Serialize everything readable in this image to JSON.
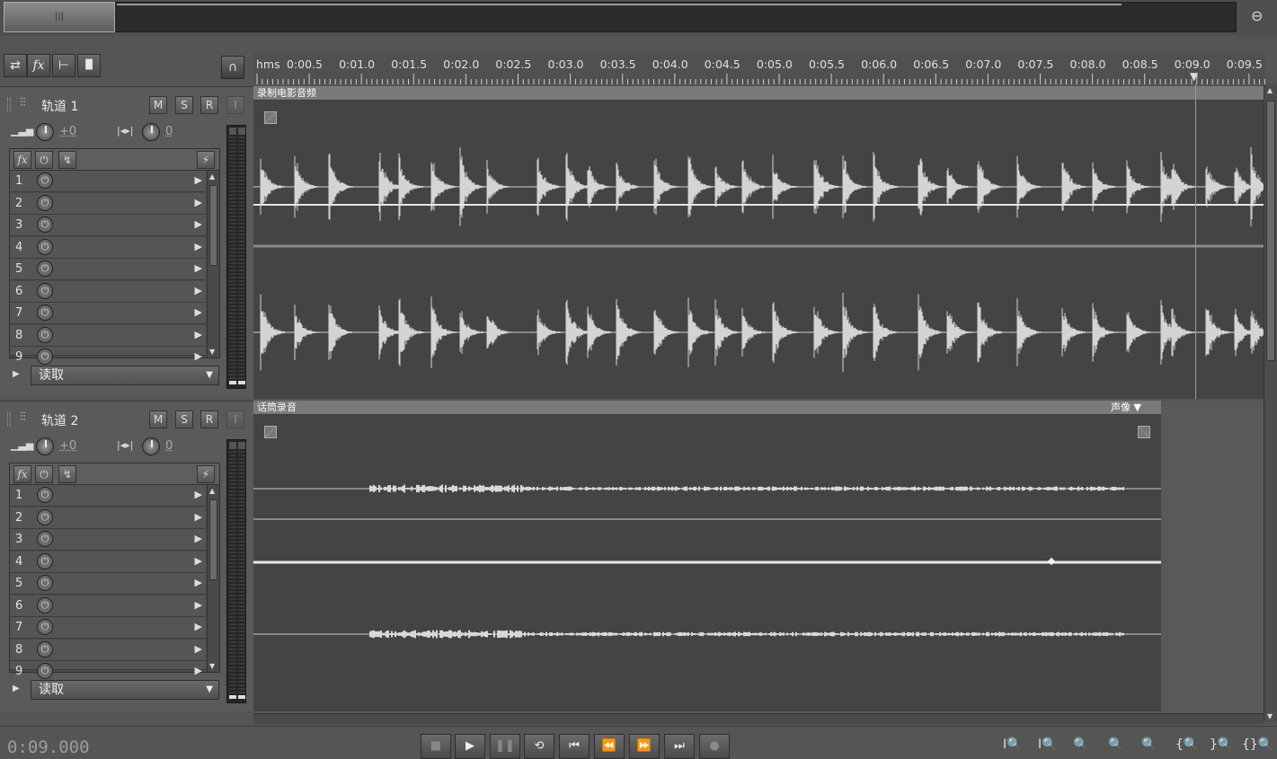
{
  "app": {
    "accent": "#d0d0d0",
    "bg": "#4d4d4d"
  },
  "overview": {
    "thumb_grip": "|||",
    "zoom_icon": "zoom-full-icon"
  },
  "tools": [
    {
      "name": "toggle-view-icon",
      "glyph": "⇄"
    },
    {
      "name": "fx-icon",
      "glyph": "fx"
    },
    {
      "name": "send-icon",
      "glyph": "⊢"
    },
    {
      "name": "eq-icon",
      "glyph": "▐▌"
    }
  ],
  "ruler": {
    "unit": "hms",
    "labels": [
      "0:00.5",
      "0:01.0",
      "0:01.5",
      "0:02.0",
      "0:02.5",
      "0:03.0",
      "0:03.5",
      "0:04.0",
      "0:04.5",
      "0:05.0",
      "0:05.5",
      "0:06.0",
      "0:06.5",
      "0:07.0",
      "0:07.5",
      "0:08.0",
      "0:08.5",
      "0:09.0",
      "0:09.5"
    ]
  },
  "tracks": [
    {
      "name": "轨道 1",
      "mute": "M",
      "solo": "S",
      "record": "R",
      "input": "I",
      "volume": "+0",
      "pan": "0",
      "fx_slots": [
        "1",
        "2",
        "3",
        "4",
        "5",
        "6",
        "7",
        "8",
        "9"
      ],
      "automation": "读取",
      "clip": {
        "title": "录制电影音频",
        "fades": "fade-in"
      }
    },
    {
      "name": "轨道 2",
      "mute": "M",
      "solo": "S",
      "record": "R",
      "input": "I",
      "volume": "+0",
      "pan": "0",
      "fx_slots": [
        "1",
        "2",
        "3",
        "4",
        "5",
        "6",
        "7",
        "8",
        "9"
      ],
      "automation": "读取",
      "clip": {
        "title": "话筒录音",
        "channel_label": "声像"
      }
    }
  ],
  "transport": {
    "time": "0:09.000",
    "buttons": [
      "■",
      "▶",
      "❚❚",
      "⟲",
      "⏮",
      "⏪",
      "⏩",
      "⏭",
      "●"
    ]
  },
  "zoom_buttons": [
    "I🔍",
    "I🔍",
    "🔍",
    "🔍",
    "🔍",
    "{🔍",
    "}🔍",
    "{}🔍"
  ]
}
